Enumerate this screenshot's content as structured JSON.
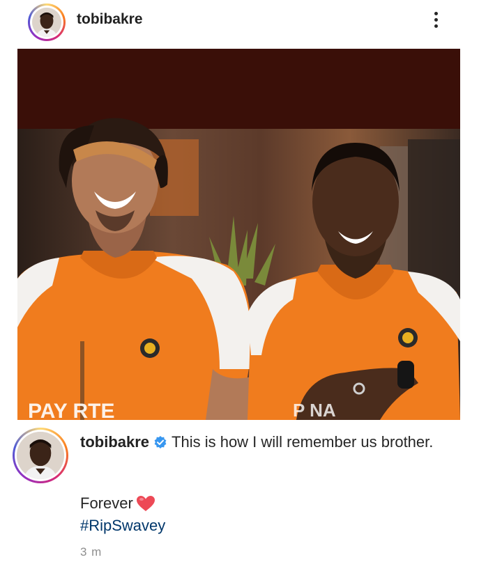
{
  "post": {
    "username": "tobibakre",
    "caption": {
      "username": "tobibakre",
      "text": "This is how I will remember us brother.",
      "line2": "Forever",
      "hashtag": "#RipSwavey"
    },
    "timestamp": "3 m",
    "photo_text_left": "PAY  RTE",
    "photo_text_right": "P    NA",
    "icons": {
      "more": "more-vertical-icon",
      "verified": "verified-badge-icon",
      "heart": "red-heart-icon"
    },
    "colors": {
      "verified": "#3897f0",
      "heart": "#ed4956",
      "hashtag": "#00376b",
      "timestamp": "#8e8e8e",
      "jersey_orange": "#f07c1e",
      "banner_dark": "#3a0f08"
    }
  }
}
